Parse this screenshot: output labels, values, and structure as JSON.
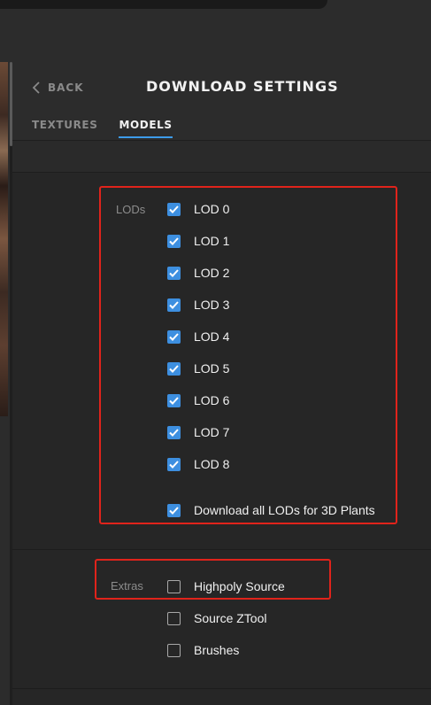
{
  "header": {
    "back_label": "BACK",
    "title": "DOWNLOAD SETTINGS",
    "tabs": [
      {
        "label": "TEXTURES",
        "active": false
      },
      {
        "label": "MODELS",
        "active": true
      }
    ]
  },
  "lods": {
    "label": "LODs",
    "items": [
      {
        "label": "LOD 0",
        "checked": true
      },
      {
        "label": "LOD 1",
        "checked": true
      },
      {
        "label": "LOD 2",
        "checked": true
      },
      {
        "label": "LOD 3",
        "checked": true
      },
      {
        "label": "LOD 4",
        "checked": true
      },
      {
        "label": "LOD 5",
        "checked": true
      },
      {
        "label": "LOD 6",
        "checked": true
      },
      {
        "label": "LOD 7",
        "checked": true
      },
      {
        "label": "LOD 8",
        "checked": true
      }
    ],
    "all_plants": {
      "label": "Download all LODs for 3D Plants",
      "checked": true
    }
  },
  "extras": {
    "label": "Extras",
    "items": [
      {
        "label": "Highpoly Source",
        "checked": false
      },
      {
        "label": "Source ZTool",
        "checked": false
      },
      {
        "label": "Brushes",
        "checked": false
      }
    ]
  },
  "colors": {
    "accent": "#3d8fe0",
    "highlight": "#e0231b",
    "panel_bg": "#262626"
  }
}
